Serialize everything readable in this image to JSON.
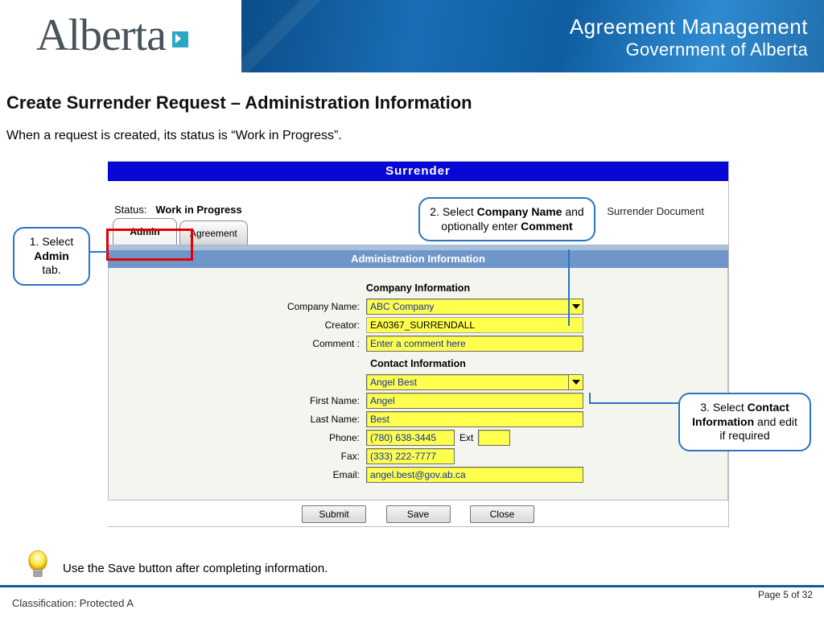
{
  "header": {
    "logo_text": "Alberta",
    "title_line1": "Agreement Management",
    "title_line2": "Government of Alberta"
  },
  "page": {
    "title": "Create Surrender Request – Administration Information",
    "intro": "When a request is created, its status is “Work in Progress”.",
    "tip": "Use the Save button after completing information.",
    "classification": "Classification: Protected A",
    "page_number": "Page 5 of 32"
  },
  "callouts": {
    "c1_pre": "1. Select ",
    "c1_bold": "Admin",
    "c1_post": " tab.",
    "c2_pre": "2. Select ",
    "c2_bold1": "Company Name",
    "c2_mid": " and optionally enter ",
    "c2_bold2": "Comment",
    "c3_pre": "3. Select ",
    "c3_bold": "Contact Information",
    "c3_post": " and edit if required"
  },
  "app": {
    "banner": "Surrender",
    "status_label": "Status:",
    "status_value": "Work in Progress",
    "right_link": "Surrender Document",
    "tabs": {
      "admin": "Admin",
      "agreement": "Agreement"
    },
    "section_bar": "Administration Information",
    "company_heading": "Company Information",
    "contact_heading": "Contact Information",
    "labels": {
      "company_name": "Company Name:",
      "creator": "Creator:",
      "comment": "Comment :",
      "first_name": "First Name:",
      "last_name": "Last Name:",
      "phone": "Phone:",
      "ext": "Ext",
      "fax": "Fax:",
      "email": "Email:"
    },
    "values": {
      "company_name": "ABC Company",
      "creator": "EA0367_SURRENDALL",
      "comment": "Enter a comment here",
      "contact_select": "Angel Best",
      "first_name": "Angel",
      "last_name": "Best",
      "phone": "(780) 638-3445",
      "ext": "",
      "fax": "(333) 222-7777",
      "email": "angel.best@gov.ab.ca"
    },
    "buttons": {
      "submit": "Submit",
      "save": "Save",
      "close": "Close"
    }
  }
}
